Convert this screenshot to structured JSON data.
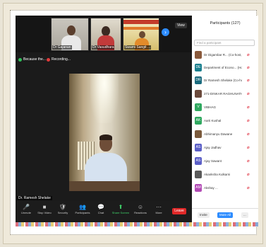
{
  "window": {
    "view_label": "View"
  },
  "thumbnails": [
    {
      "name": "Dr Gajanan"
    },
    {
      "name": "Dr Vasudhara"
    },
    {
      "name": "Swami Sangit ..."
    }
  ],
  "top_controls": {
    "recording": "Recording...",
    "reason": "Because the..."
  },
  "main_speaker": {
    "name": "Dr. Ramesh Shelake"
  },
  "toolbar": {
    "items": [
      {
        "icon": "🎤",
        "label": "Unmute"
      },
      {
        "icon": "■",
        "label": "Stop Video"
      },
      {
        "icon": "🛡",
        "label": "Security"
      },
      {
        "icon": "👥",
        "label": "Participants"
      },
      {
        "icon": "💬",
        "label": "Chat"
      },
      {
        "icon": "⬆",
        "label": "Share Screen"
      },
      {
        "icon": "☺",
        "label": "Reactions"
      },
      {
        "icon": "⋯",
        "label": "More"
      }
    ],
    "leave": "Leave"
  },
  "participants": {
    "title": "Participants (127)",
    "search_placeholder": "Find a participant",
    "list": [
      {
        "initials": "",
        "name": "Dr Digambar R... (Co-host, me)",
        "color": "#8a5a3c"
      },
      {
        "initials": "DE",
        "name": "Department of Econo... (Host)",
        "color": "#1a7f8e"
      },
      {
        "initials": "DR",
        "name": "Dr Ramesh Shelake (Co-host)",
        "color": "#1a6b7e"
      },
      {
        "initials": "",
        "name": "271-DINKAR RAGHUNATH",
        "color": "#6b4a3c"
      },
      {
        "initials": "V",
        "name": "VIBHAG",
        "color": "#2fa85f"
      },
      {
        "initials": "AK",
        "name": "Aarti Kushal",
        "color": "#2fa85f"
      },
      {
        "initials": "",
        "name": "Abhimanyu Dawane",
        "color": "#7a5a3c"
      },
      {
        "initials": "AS",
        "name": "Ajay Jadhav",
        "color": "#5b5fc7"
      },
      {
        "initials": "AS",
        "name": "Ajay Sawant",
        "color": "#5b5fc7"
      },
      {
        "initials": "",
        "name": "Akanksha Kulkarni",
        "color": "#5a5a5a"
      },
      {
        "initials": "AM",
        "name": "Akshay ...",
        "color": "#b24ab5"
      }
    ],
    "invite": "Invite",
    "mute_all": "Mute All",
    "more": "..."
  }
}
